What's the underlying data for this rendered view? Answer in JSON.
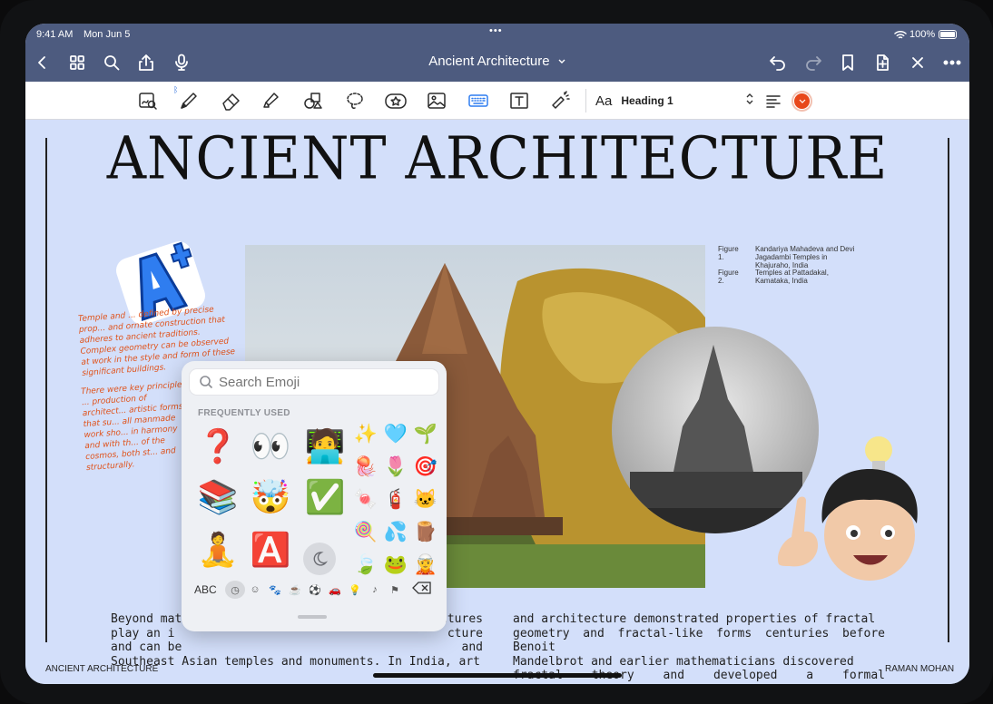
{
  "status_bar": {
    "time": "9:41 AM",
    "date": "Mon Jun 5",
    "battery": "100%"
  },
  "nav": {
    "title": "Ancient Architecture",
    "title_icon": "chevron-down-icon"
  },
  "toolbar": {
    "style_prefix": "Aa",
    "style_label": "Heading 1",
    "accent_color": "#e8481b"
  },
  "document": {
    "heading": "ANCIENT ARCHITECTURE",
    "captions": {
      "fig1_label": "Figure 1.",
      "fig1_text": "Kandariya Mahadeva and Devi Jagadambi Temples in Khajuraho, India",
      "fig2_label": "Figure 2.",
      "fig2_text": "Temples at Pattadakal, Kamataka, India"
    },
    "handwritten_1": "Temple and ... defined by precise prop... and ornate construction that adheres to ancient traditions. Complex geometry can be observed at work in the style and form of these significant buildings.",
    "handwritten_2": "There were key principles ... production of architect... artistic forms that su... all manmade work sho... in harmony and with th... of the cosmos, both st... and structurally.",
    "body_left_lines": [
      "Beyond math",
      "play an  i",
      "and can be",
      "Southeast Asian temples and monuments. In India, art"
    ],
    "body_left_right_fragments": [
      "ctures",
      "cture",
      "and",
      ""
    ],
    "body_right_lines": [
      "and architecture demonstrated properties of fractal",
      "geometry and fractal-like forms centuries before Benoit",
      "Mandelbrot  and  earlier  mathematicians  discovered",
      "fractal theory and developed a formal classification."
    ],
    "footer_left": "ANCIENT ARCHITECTURE",
    "footer_right": "RAMAN MOHAN"
  },
  "emoji_panel": {
    "search_placeholder": "Search Emoji",
    "section_title": "FREQUENTLY USED",
    "large": [
      "❓",
      "👀",
      "🧑‍💻",
      "📚",
      "🤯",
      "✅",
      "🧘",
      "🅰️"
    ],
    "small": [
      "✨",
      "🩵",
      "🌱",
      "🪼",
      "🌷",
      "🎯",
      "🍬",
      "🧯",
      "🐱",
      "🍭",
      "💦",
      "🪵",
      "🍃",
      "🐸",
      "🧝"
    ],
    "abc_label": "ABC",
    "categories": [
      "recent-icon",
      "smiley-icon",
      "animal-icon",
      "food-icon",
      "sport-icon",
      "travel-icon",
      "object-icon",
      "symbol-icon",
      "flag-icon"
    ]
  }
}
